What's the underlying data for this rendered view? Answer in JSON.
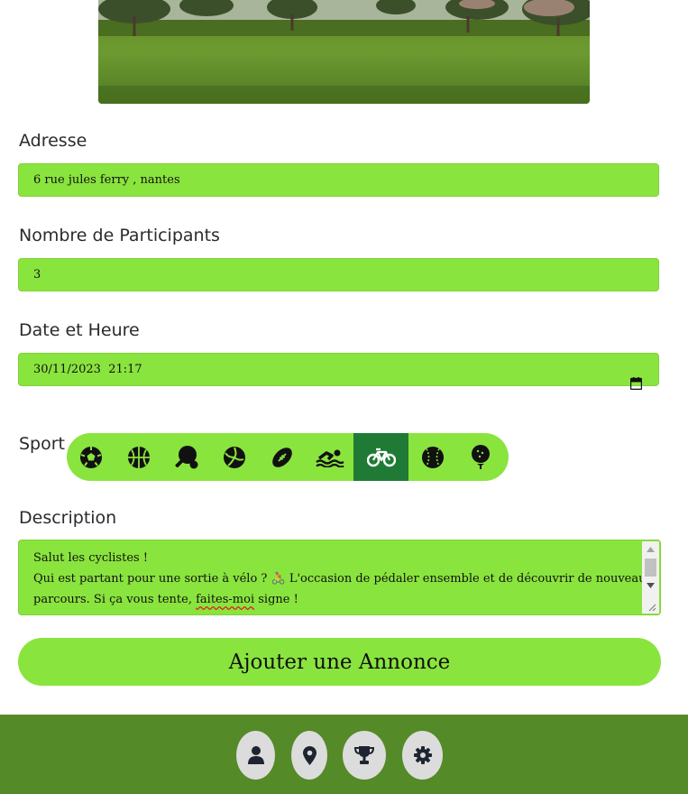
{
  "form": {
    "address_label": "Adresse",
    "address_value": "6 rue jules ferry , nantes",
    "participants_label": "Nombre de Participants",
    "participants_value": "3",
    "datetime_label": "Date et Heure",
    "datetime_value": "30/11/2023  21:17",
    "sport_label": "Sport",
    "sports": [
      {
        "icon": "soccer-ball-icon",
        "selected": false
      },
      {
        "icon": "basketball-icon",
        "selected": false
      },
      {
        "icon": "ping-pong-icon",
        "selected": false
      },
      {
        "icon": "volleyball-icon",
        "selected": false
      },
      {
        "icon": "american-football-icon",
        "selected": false
      },
      {
        "icon": "swimming-icon",
        "selected": false
      },
      {
        "icon": "bicycle-icon",
        "selected": true
      },
      {
        "icon": "baseball-icon",
        "selected": false
      },
      {
        "icon": "golf-icon",
        "selected": false
      }
    ],
    "description_label": "Description",
    "description_lines": [
      "Salut les cyclistes !",
      "Qui est partant pour une sortie à vélo ? 🚴 L'occasion de pédaler ensemble et de découvrir de nouveaux",
      "parcours. Si ça vous tente, ",
      "faites-moi",
      " signe !"
    ],
    "submit_label": "Ajouter une Annonce"
  },
  "footer_nav": [
    {
      "icon": "user-icon"
    },
    {
      "icon": "location-pin-icon"
    },
    {
      "icon": "trophy-icon"
    },
    {
      "icon": "gear-icon"
    }
  ],
  "colors": {
    "field_bg": "#8ae43e",
    "selected_sport_bg": "#1f7a35",
    "footer_bg": "#548a27",
    "nav_button_bg": "#dcdcdc"
  }
}
